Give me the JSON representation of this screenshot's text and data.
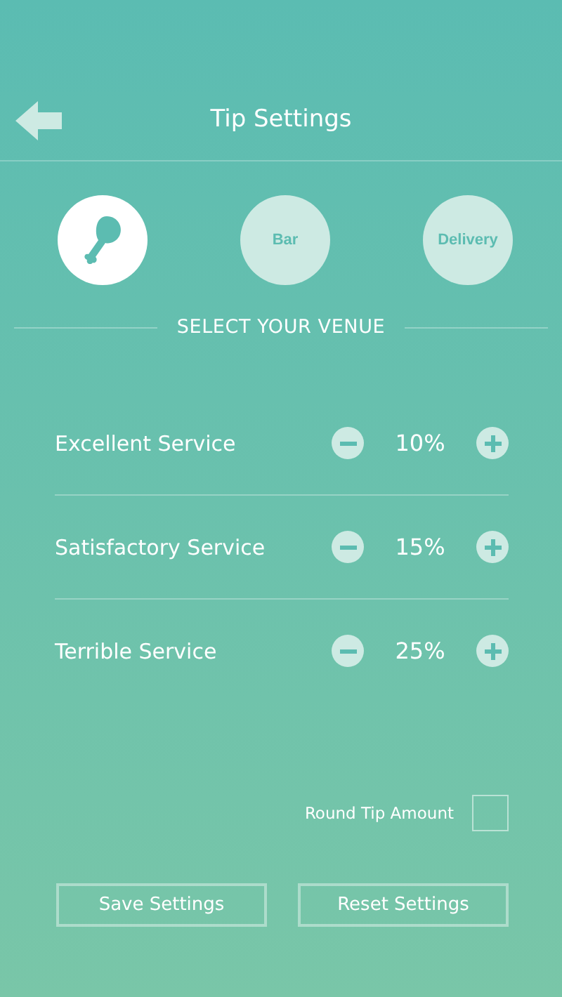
{
  "header": {
    "title": "Tip Settings"
  },
  "venues": [
    {
      "kind": "icon",
      "selected": true
    },
    {
      "kind": "text",
      "label": "Bar",
      "selected": false
    },
    {
      "kind": "text",
      "label": "Delivery",
      "selected": false
    }
  ],
  "venue_heading": "SELECT YOUR VENUE",
  "services": [
    {
      "name": "Excellent Service",
      "value": "10%"
    },
    {
      "name": "Satisfactory Service",
      "value": "15%"
    },
    {
      "name": "Terrible Service",
      "value": "25%"
    }
  ],
  "round_tip": {
    "label": "Round Tip Amount",
    "checked": false
  },
  "buttons": [
    "Save Settings",
    "Reset Settings"
  ]
}
